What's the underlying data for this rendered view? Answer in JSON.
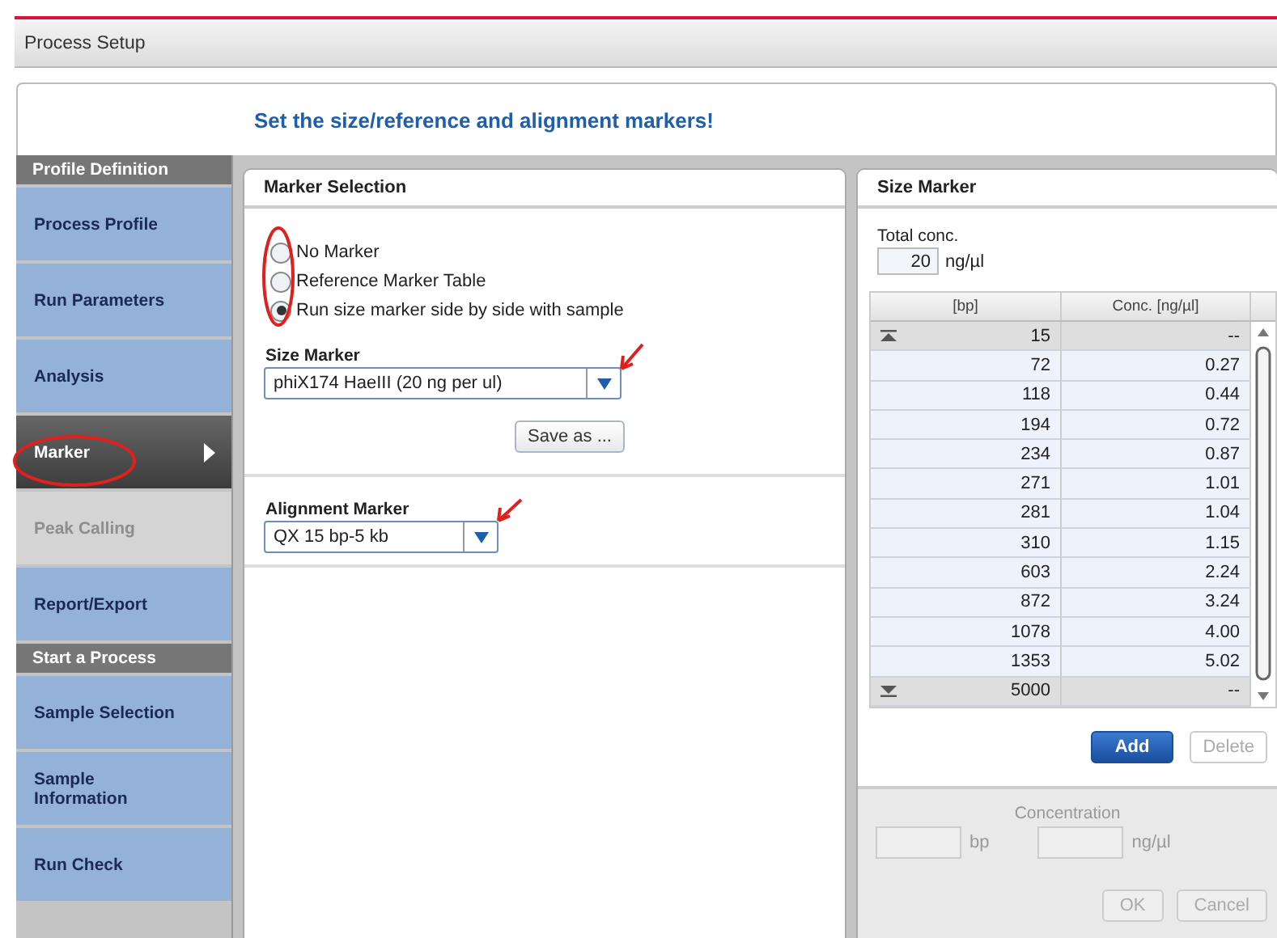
{
  "window": {
    "title": "Process Setup"
  },
  "heading": "Set the size/reference and alignment markers!",
  "sidebar": {
    "sections": [
      {
        "title": "Profile Definition",
        "items": [
          {
            "label": "Process Profile",
            "selected": false,
            "disabled": false
          },
          {
            "label": "Run Parameters",
            "selected": false,
            "disabled": false
          },
          {
            "label": "Analysis",
            "selected": false,
            "disabled": false
          },
          {
            "label": "Marker",
            "selected": true,
            "disabled": false
          },
          {
            "label": "Peak Calling",
            "selected": false,
            "disabled": true
          },
          {
            "label": "Report/Export",
            "selected": false,
            "disabled": false
          }
        ]
      },
      {
        "title": "Start a Process",
        "items": [
          {
            "label": "Sample Selection",
            "selected": false,
            "disabled": false
          },
          {
            "label": "Sample Information",
            "selected": false,
            "disabled": false
          },
          {
            "label": "Run Check",
            "selected": false,
            "disabled": false
          }
        ]
      }
    ]
  },
  "marker_selection": {
    "title": "Marker Selection",
    "options": [
      {
        "label": "No Marker",
        "selected": false
      },
      {
        "label": "Reference Marker Table",
        "selected": false
      },
      {
        "label": "Run size marker side by side with sample",
        "selected": true
      }
    ],
    "size_marker": {
      "label": "Size Marker",
      "value": "phiX174 HaeIII (20 ng per ul)"
    },
    "save_button": "Save as ...",
    "alignment_marker": {
      "label": "Alignment Marker",
      "value": "QX 15 bp-5 kb"
    }
  },
  "size_marker": {
    "title": "Size Marker",
    "total_label": "Total conc.",
    "total_value": "20",
    "total_unit": "ng/µl",
    "columns": [
      "[bp]",
      "Conc. [ng/µl]"
    ],
    "rows": [
      {
        "kind": "lower",
        "bp": "15",
        "conc": "--"
      },
      {
        "kind": "normal",
        "bp": "72",
        "conc": "0.27"
      },
      {
        "kind": "normal",
        "bp": "118",
        "conc": "0.44"
      },
      {
        "kind": "normal",
        "bp": "194",
        "conc": "0.72"
      },
      {
        "kind": "normal",
        "bp": "234",
        "conc": "0.87"
      },
      {
        "kind": "normal",
        "bp": "271",
        "conc": "1.01"
      },
      {
        "kind": "normal",
        "bp": "281",
        "conc": "1.04"
      },
      {
        "kind": "normal",
        "bp": "310",
        "conc": "1.15"
      },
      {
        "kind": "normal",
        "bp": "603",
        "conc": "2.24"
      },
      {
        "kind": "normal",
        "bp": "872",
        "conc": "3.24"
      },
      {
        "kind": "normal",
        "bp": "1078",
        "conc": "4.00"
      },
      {
        "kind": "normal",
        "bp": "1353",
        "conc": "5.02"
      },
      {
        "kind": "upper",
        "bp": "5000",
        "conc": "--"
      }
    ],
    "buttons": [
      {
        "label": "Add",
        "disabled": false,
        "kind": "primary"
      },
      {
        "label": "Delete",
        "disabled": true,
        "kind": "plain"
      }
    ],
    "edit": {
      "title": "Concentration",
      "bp_unit": "bp",
      "conc_unit": "ng/µl",
      "buttons": [
        {
          "label": "OK",
          "disabled": true
        },
        {
          "label": "Cancel",
          "disabled": true
        }
      ]
    }
  }
}
